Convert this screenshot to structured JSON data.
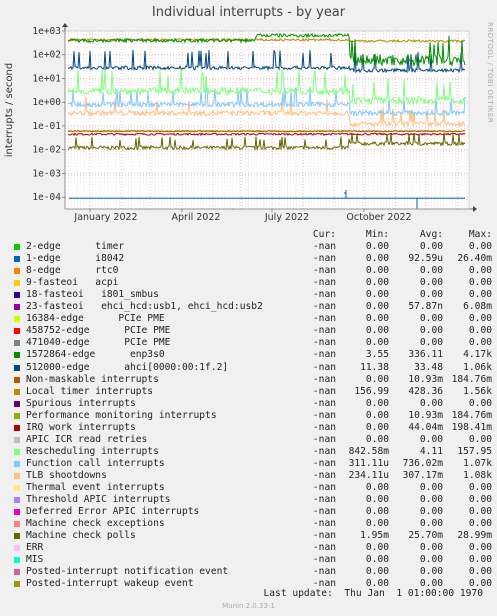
{
  "chart_data": {
    "type": "line",
    "title": "Individual interrupts - by year",
    "ylabel": "interrupts / second",
    "yscale": "log",
    "ylim": [
      5e-05,
      2000
    ],
    "yticks": [
      "1e+03",
      "1e+02",
      "1e+01",
      "1e+00",
      "1e-01",
      "1e-02",
      "1e-03",
      "1e-04"
    ],
    "xticks": [
      "January 2022",
      "April 2022",
      "July 2022",
      "October 2022"
    ],
    "grid": true,
    "columns": [
      "Cur:",
      "Min:",
      "Avg:",
      "Max:"
    ],
    "series": [
      {
        "name": "2-edge      timer",
        "color": "#00cc00",
        "cur": "-nan",
        "min": "0.00",
        "avg": "0.00",
        "max": "0.00"
      },
      {
        "name": "1-edge      i8042",
        "color": "#0066b3",
        "cur": "-nan",
        "min": "0.00",
        "avg": "92.59u",
        "max": "26.40m",
        "profile": "spike1"
      },
      {
        "name": "8-edge      rtc0",
        "color": "#ff8000",
        "cur": "-nan",
        "min": "0.00",
        "avg": "0.00",
        "max": "0.00"
      },
      {
        "name": "9-fasteoi   acpi",
        "color": "#ffcc00",
        "cur": "-nan",
        "min": "0.00",
        "avg": "0.00",
        "max": "0.00"
      },
      {
        "name": "18-fasteoi   i801_smbus",
        "color": "#330099",
        "cur": "-nan",
        "min": "0.00",
        "avg": "0.00",
        "max": "0.00"
      },
      {
        "name": "23-fasteoi   ehci_hcd:usb1, ehci_hcd:usb2",
        "color": "#990099",
        "cur": "-nan",
        "min": "0.00",
        "avg": "57.87n",
        "max": "6.08m",
        "profile": "spike2"
      },
      {
        "name": "16384-edge      PCIe PME",
        "color": "#ccff00",
        "cur": "-nan",
        "min": "0.00",
        "avg": "0.00",
        "max": "0.00"
      },
      {
        "name": "458752-edge      PCIe PME",
        "color": "#ff0000",
        "cur": "-nan",
        "min": "0.00",
        "avg": "0.00",
        "max": "0.00"
      },
      {
        "name": "471040-edge      PCIe PME",
        "color": "#808080",
        "cur": "-nan",
        "min": "0.00",
        "avg": "0.00",
        "max": "0.00"
      },
      {
        "name": "1572864-edge      enp3s0",
        "color": "#008f00",
        "cur": "-nan",
        "min": "3.55",
        "avg": "336.11",
        "max": "4.17k",
        "profile": "top"
      },
      {
        "name": "512000-edge      ahci[0000:00:1f.2]",
        "color": "#00487d",
        "cur": "-nan",
        "min": "11.38",
        "avg": "33.48",
        "max": "1.06k",
        "profile": "ahci"
      },
      {
        "name": "Non-maskable interrupts",
        "color": "#b35a00",
        "cur": "-nan",
        "min": "0.00",
        "avg": "10.93m",
        "max": "184.76m",
        "profile": "nmi"
      },
      {
        "name": "Local timer interrupts",
        "color": "#b38f00",
        "cur": "-nan",
        "min": "156.99",
        "avg": "428.36",
        "max": "1.56k",
        "profile": "loc"
      },
      {
        "name": "Spurious interrupts",
        "color": "#6b006b",
        "cur": "-nan",
        "min": "0.00",
        "avg": "0.00",
        "max": "0.00"
      },
      {
        "name": "Performance monitoring interrupts",
        "color": "#8fb300",
        "cur": "-nan",
        "min": "0.00",
        "avg": "10.93m",
        "max": "184.76m",
        "profile": "pmi"
      },
      {
        "name": "IRQ work interrupts",
        "color": "#b30000",
        "cur": "-nan",
        "min": "0.00",
        "avg": "44.04m",
        "max": "198.41m",
        "profile": "iwi"
      },
      {
        "name": "APIC ICR read retries",
        "color": "#bebebe",
        "cur": "-nan",
        "min": "0.00",
        "avg": "0.00",
        "max": "0.00"
      },
      {
        "name": "Rescheduling interrupts",
        "color": "#80ff80",
        "cur": "-nan",
        "min": "842.58m",
        "avg": "4.11",
        "max": "157.95",
        "profile": "res"
      },
      {
        "name": "Function call interrupts",
        "color": "#80c9ff",
        "cur": "-nan",
        "min": "311.11u",
        "avg": "736.02m",
        "max": "1.07k",
        "profile": "cal"
      },
      {
        "name": "TLB shootdowns",
        "color": "#ffc080",
        "cur": "-nan",
        "min": "234.11u",
        "avg": "307.17m",
        "max": "1.08k",
        "profile": "tlb"
      },
      {
        "name": "Thermal event interrupts",
        "color": "#ffe680",
        "cur": "-nan",
        "min": "0.00",
        "avg": "0.00",
        "max": "0.00"
      },
      {
        "name": "Threshold APIC interrupts",
        "color": "#aa80ff",
        "cur": "-nan",
        "min": "0.00",
        "avg": "0.00",
        "max": "0.00"
      },
      {
        "name": "Deferred Error APIC interrupts",
        "color": "#ee00cc",
        "cur": "-nan",
        "min": "0.00",
        "avg": "0.00",
        "max": "0.00"
      },
      {
        "name": "Machine check exceptions",
        "color": "#ff8080",
        "cur": "-nan",
        "min": "0.00",
        "avg": "0.00",
        "max": "0.00"
      },
      {
        "name": "Machine check polls",
        "color": "#666600",
        "cur": "-nan",
        "min": "1.95m",
        "avg": "25.70m",
        "max": "28.99m",
        "profile": "mcp"
      },
      {
        "name": "ERR",
        "color": "#ffbfff",
        "cur": "-nan",
        "min": "0.00",
        "avg": "0.00",
        "max": "0.00"
      },
      {
        "name": "MIS",
        "color": "#00ffcc",
        "cur": "-nan",
        "min": "0.00",
        "avg": "0.00",
        "max": "0.00"
      },
      {
        "name": "Posted-interrupt notification event",
        "color": "#cc6699",
        "cur": "-nan",
        "min": "0.00",
        "avg": "0.00",
        "max": "0.00"
      },
      {
        "name": "Posted-interrupt wakeup event",
        "color": "#999900",
        "cur": "-nan",
        "min": "0.00",
        "avg": "0.00",
        "max": "0.00"
      }
    ]
  },
  "side_label": "RRDTOOL / TOBI OETIKER",
  "last_update": "Last update:  Thu Jan  1 01:00:00 1970",
  "munin_version": "Munin 2.0.33-1"
}
